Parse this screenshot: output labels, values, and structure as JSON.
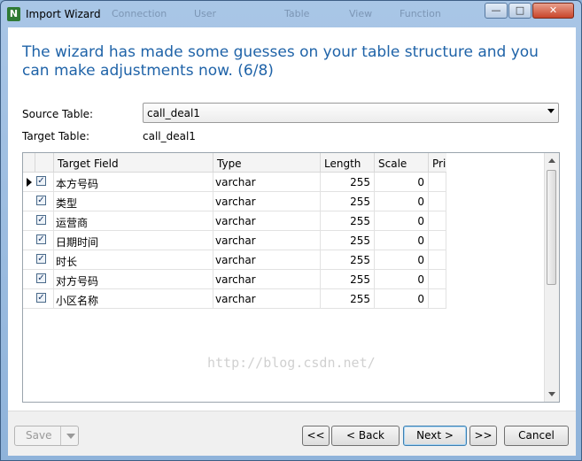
{
  "window": {
    "title": "Import Wizard",
    "icon_name": "navicat-app-icon",
    "ghost_menu": [
      "Connection",
      "User",
      "Table",
      "View",
      "Function"
    ],
    "controls": {
      "minimize": "—",
      "maximize": "□",
      "close": "✕"
    }
  },
  "wizard": {
    "heading": "The wizard has made some guesses on your table structure and you can make adjustments now. (6/8)",
    "source_label": "Source Table:",
    "source_value": "call_deal1",
    "target_label": "Target Table:",
    "target_value": "call_deal1"
  },
  "grid": {
    "columns": [
      "Target Field",
      "Type",
      "Length",
      "Scale",
      "Pri"
    ],
    "rows": [
      {
        "field": "本方号码",
        "type": "varchar",
        "length": "255",
        "scale": "0",
        "checked": true,
        "current": true
      },
      {
        "field": "类型",
        "type": "varchar",
        "length": "255",
        "scale": "0",
        "checked": true,
        "current": false
      },
      {
        "field": "运营商",
        "type": "varchar",
        "length": "255",
        "scale": "0",
        "checked": true,
        "current": false
      },
      {
        "field": "日期时间",
        "type": "varchar",
        "length": "255",
        "scale": "0",
        "checked": true,
        "current": false
      },
      {
        "field": "时长",
        "type": "varchar",
        "length": "255",
        "scale": "0",
        "checked": true,
        "current": false
      },
      {
        "field": "对方号码",
        "type": "varchar",
        "length": "255",
        "scale": "0",
        "checked": true,
        "current": false
      },
      {
        "field": "小区名称",
        "type": "varchar",
        "length": "255",
        "scale": "0",
        "checked": true,
        "current": false
      }
    ],
    "watermark": "http://blog.csdn.net/"
  },
  "footer": {
    "save": "Save",
    "first": "<<",
    "back": "< Back",
    "next": "Next >",
    "last": ">>",
    "cancel": "Cancel"
  },
  "colors": {
    "heading": "#1f63a8",
    "title_bar": "#a9c6e6"
  }
}
